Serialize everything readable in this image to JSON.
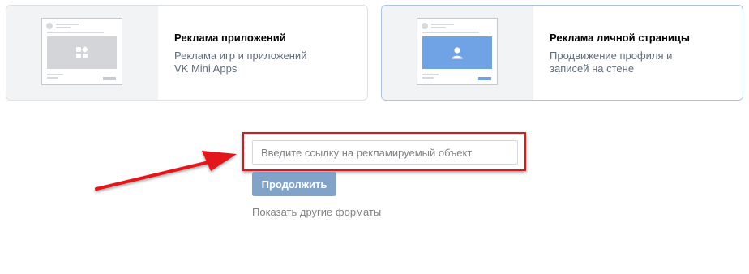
{
  "cards": [
    {
      "title": "Реклама приложений",
      "description": "Реклама игр и приложений VK Mini Apps",
      "icon": "apps-grid-icon",
      "selected": false
    },
    {
      "title": "Реклама личной страницы",
      "description": "Продвижение профиля и записей на стене",
      "icon": "user-profile-icon",
      "selected": true
    }
  ],
  "form": {
    "url_placeholder": "Введите ссылку на рекламируемый объект",
    "url_value": "",
    "continue_label": "Продолжить",
    "other_formats_label": "Показать другие форматы"
  },
  "annotation": {
    "arrow_color": "#e3151a",
    "highlight_color": "#e3151a"
  },
  "colors": {
    "accent": "#5181b8",
    "button_disabled": "#81a3c7",
    "selected_media": "#6fa3e6"
  }
}
